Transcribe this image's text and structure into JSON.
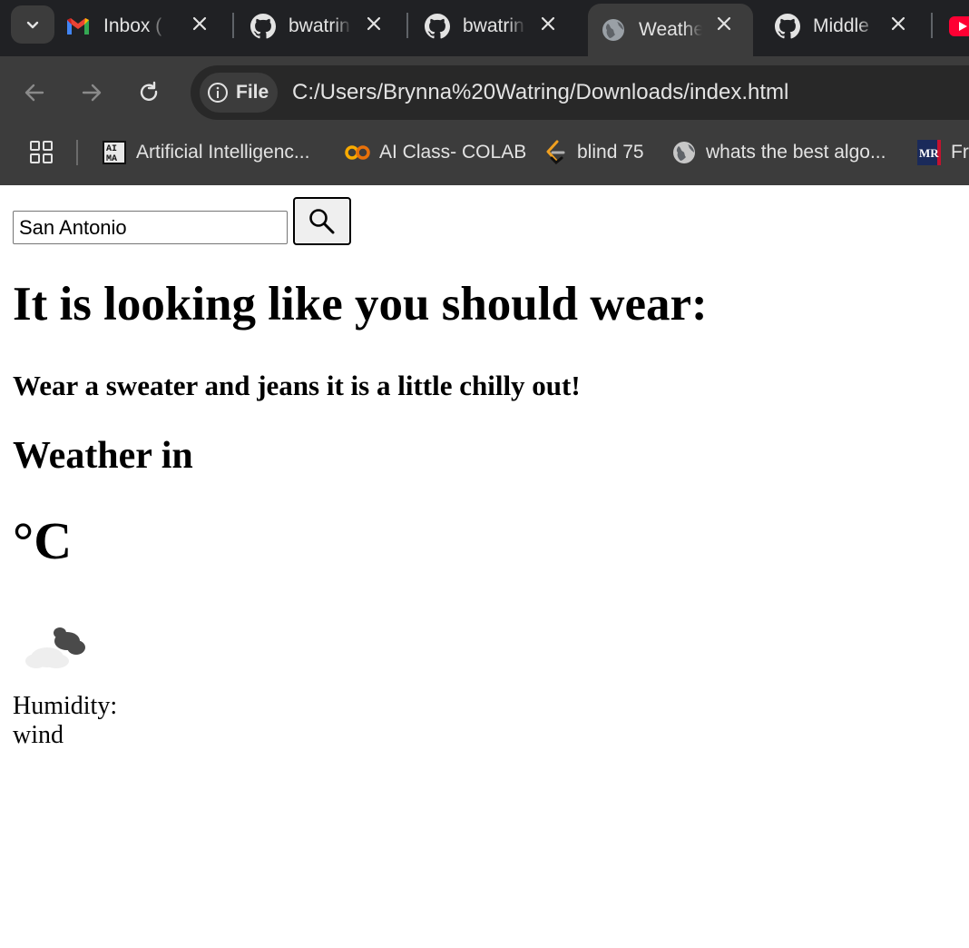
{
  "tabs": [
    {
      "title": "Inbox (",
      "favicon": "gmail-icon",
      "active": false
    },
    {
      "title": "bwatrin",
      "favicon": "github-icon",
      "active": false
    },
    {
      "title": "bwatrin",
      "favicon": "github-icon",
      "active": false
    },
    {
      "title": "Weathe",
      "favicon": "globe-icon",
      "active": true
    },
    {
      "title": "Middle",
      "favicon": "github-icon",
      "active": false
    }
  ],
  "toolbar": {
    "site_chip_label": "File",
    "url": "C:/Users/Brynna%20Watring/Downloads/index.html"
  },
  "bookmarks": [
    {
      "label": "Artificial Intelligenc...",
      "icon": "aima-icon"
    },
    {
      "label": "AI Class- COLAB",
      "icon": "colab-icon"
    },
    {
      "label": "blind 75",
      "icon": "leetcode-icon"
    },
    {
      "label": "whats the best algo...",
      "icon": "globe-icon"
    },
    {
      "label": "Fr",
      "icon": "mr-icon"
    }
  ],
  "page": {
    "search": {
      "value": "San Antonio"
    },
    "advice_heading": "It is looking like you should wear:",
    "advice_text": "Wear a sweater and jeans it is a little chilly out!",
    "weather_heading": "Weather in",
    "temperature": "°C",
    "weather_icon": "cloud-night-icon",
    "humidity_label": "Humidity:",
    "wind_label": "wind"
  }
}
